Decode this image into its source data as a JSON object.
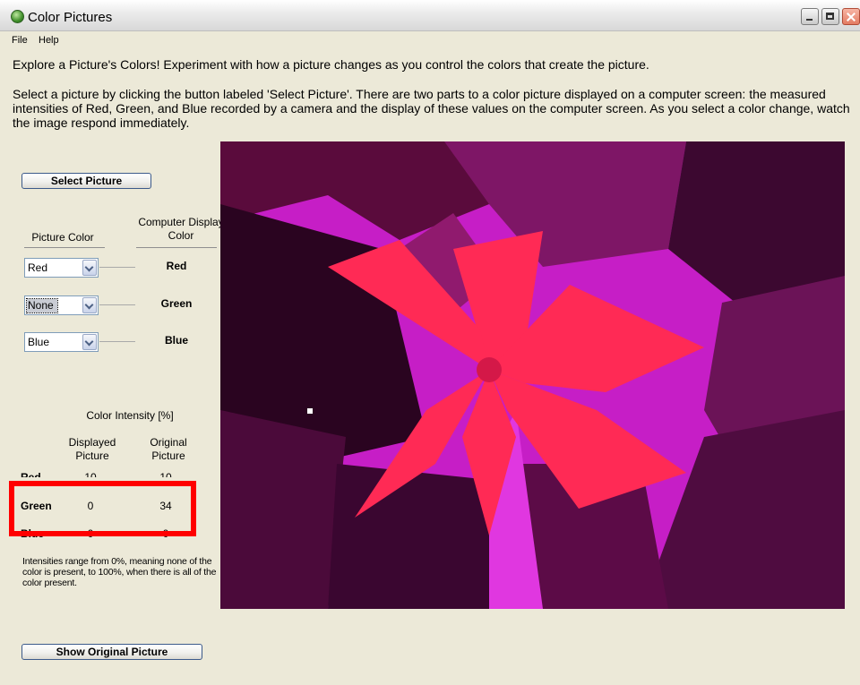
{
  "window": {
    "title": "Color Pictures"
  },
  "menu": {
    "file": "File",
    "help": "Help"
  },
  "intro": {
    "line1": "Explore a Picture's Colors!  Experiment with how a picture changes as you control the colors that create the picture.",
    "line2": "Select a picture by clicking the button labeled  'Select Picture'.  There are two parts to a color picture displayed on a computer screen: the measured intensities of Red, Green, and Blue recorded by a camera and the display of these values on the computer screen.  As you select a color change, watch the image respond immediately."
  },
  "buttons": {
    "select_picture": "Select Picture",
    "show_original": "Show Original Picture"
  },
  "mapping": {
    "picture_color_header": "Picture Color",
    "display_color_header": "Computer Display Color",
    "rows": [
      {
        "picture_color": "Red",
        "display_color": "Red"
      },
      {
        "picture_color": "None",
        "display_color": "Green"
      },
      {
        "picture_color": "Blue",
        "display_color": "Blue"
      }
    ]
  },
  "intensity": {
    "title": "Color Intensity [%]",
    "col_displayed": "Displayed Picture",
    "col_original": "Original Picture",
    "rows": [
      {
        "label": "Red",
        "displayed": "10",
        "original": "10"
      },
      {
        "label": "Green",
        "displayed": "0",
        "original": "34"
      },
      {
        "label": "Blue",
        "displayed": "0",
        "original": "0"
      }
    ],
    "note": "Intensities range from 0%, meaning none of the color is present, to 100%, when there is all of the color present."
  },
  "colors": {
    "highlight": "#ff0000",
    "photo_background": "#c61ec6",
    "flower": "#ff2a55"
  }
}
